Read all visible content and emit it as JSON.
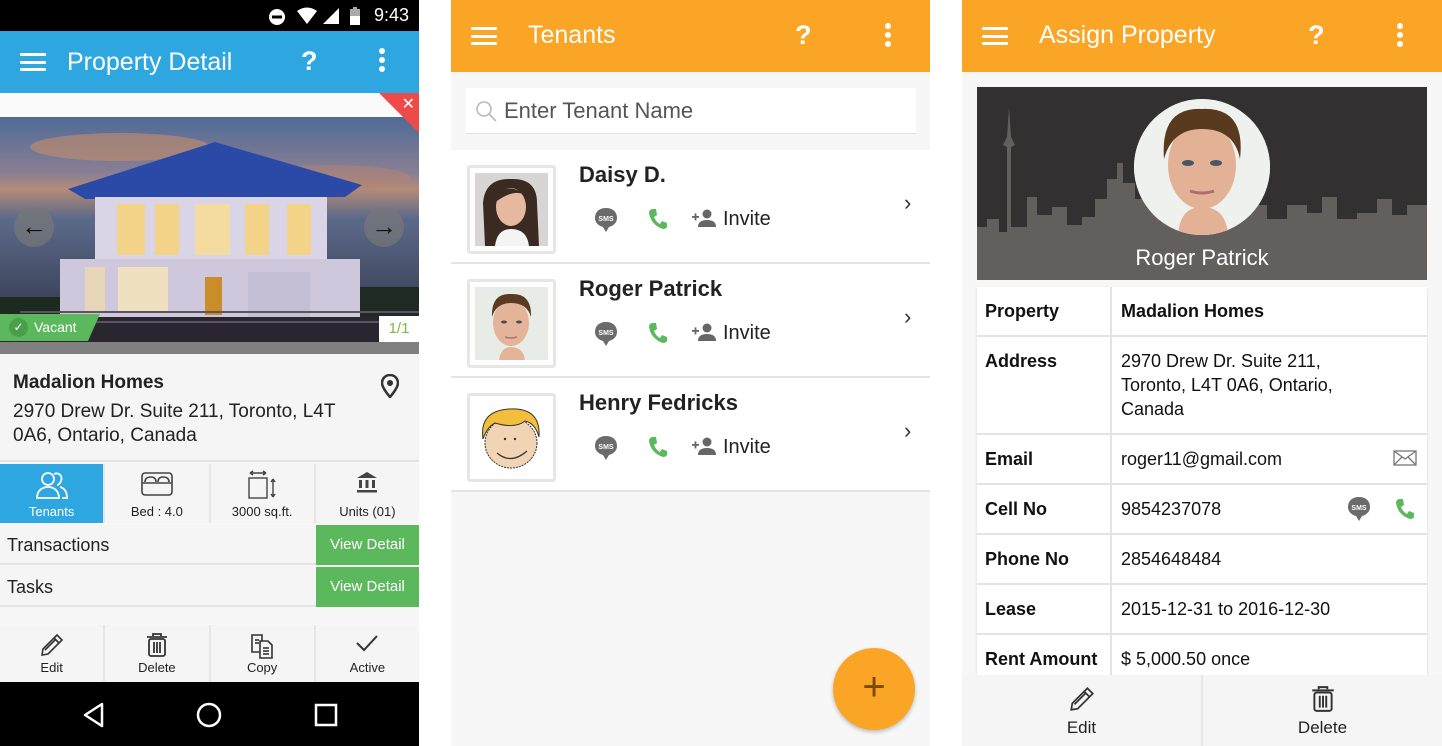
{
  "colors": {
    "blue_accent": "#2ea7e0",
    "orange_accent": "#fba526",
    "green": "#5cb85c",
    "red_close": "#ef4a4a",
    "call_green": "#5cb85c"
  },
  "property_detail": {
    "status_bar": {
      "time": "9:43",
      "icons": [
        "dnd-icon",
        "wifi-icon",
        "signal-icon",
        "battery-icon"
      ]
    },
    "app_bar": {
      "title": "Property Detail",
      "help_label": "?",
      "menu_icon": "hamburger-icon",
      "more_icon": "more-vertical-icon"
    },
    "gallery": {
      "status_badge": "Vacant",
      "counter": "1/1",
      "prev_icon": "arrow-left-icon",
      "next_icon": "arrow-right-icon",
      "close_label": "✕",
      "prev_label": "←",
      "next_label": "→"
    },
    "property": {
      "name": "Madalion Homes",
      "address": "2970   Drew Dr. Suite 211, Toronto, L4T 0A6, Ontario, Canada"
    },
    "stats": [
      {
        "label": "Tenants",
        "icon": "tenants-icon",
        "active": true
      },
      {
        "label": "Bed : 4.0",
        "icon": "bed-icon",
        "active": false
      },
      {
        "label": "3000 sq.ft.",
        "icon": "area-icon",
        "active": false
      },
      {
        "label": "Units (01)",
        "icon": "bank-icon",
        "active": false
      }
    ],
    "rows": [
      {
        "label": "Transactions",
        "button": "View Detail"
      },
      {
        "label": "Tasks",
        "button": "View Detail"
      }
    ],
    "actions": [
      {
        "label": "Edit",
        "icon": "pencil-icon"
      },
      {
        "label": "Delete",
        "icon": "trash-icon"
      },
      {
        "label": "Copy",
        "icon": "copy-icon"
      },
      {
        "label": "Active",
        "icon": "check-icon"
      }
    ],
    "system_nav": [
      "back-icon",
      "home-icon",
      "recents-icon"
    ]
  },
  "tenants": {
    "app_bar": {
      "title": "Tenants",
      "help_label": "?"
    },
    "search": {
      "placeholder": "Enter Tenant Name",
      "value": ""
    },
    "list": [
      {
        "name": "Daisy D.",
        "invite_label": "Invite",
        "sms_label": "SMS"
      },
      {
        "name": "Roger Patrick",
        "invite_label": "Invite",
        "sms_label": "SMS"
      },
      {
        "name": "Henry Fedricks",
        "invite_label": "Invite",
        "sms_label": "SMS"
      }
    ],
    "chevron": "›",
    "fab_label": "+"
  },
  "assign_property": {
    "app_bar": {
      "title": "Assign Property",
      "help_label": "?"
    },
    "tenant_name": "Roger Patrick",
    "details": [
      {
        "key": "Property",
        "value": "Madalion Homes",
        "bold_value": true
      },
      {
        "key": "Address",
        "value": "2970   Drew Dr. Suite 211, Toronto, L4T 0A6, Ontario, Canada"
      },
      {
        "key": "Email",
        "value": "roger11@gmail.com",
        "icons": [
          "mail-icon"
        ]
      },
      {
        "key": "Cell No",
        "value": "9854237078",
        "icons": [
          "sms-icon",
          "phone-icon"
        ]
      },
      {
        "key": "Phone No",
        "value": "2854648484"
      },
      {
        "key": "Lease",
        "value": "2015-12-31 to 2016-12-30"
      },
      {
        "key": "Rent Amount",
        "value": "$ 5,000.50 once"
      }
    ],
    "actions": [
      {
        "label": "Edit",
        "icon": "pencil-icon"
      },
      {
        "label": "Delete",
        "icon": "trash-icon"
      }
    ]
  }
}
